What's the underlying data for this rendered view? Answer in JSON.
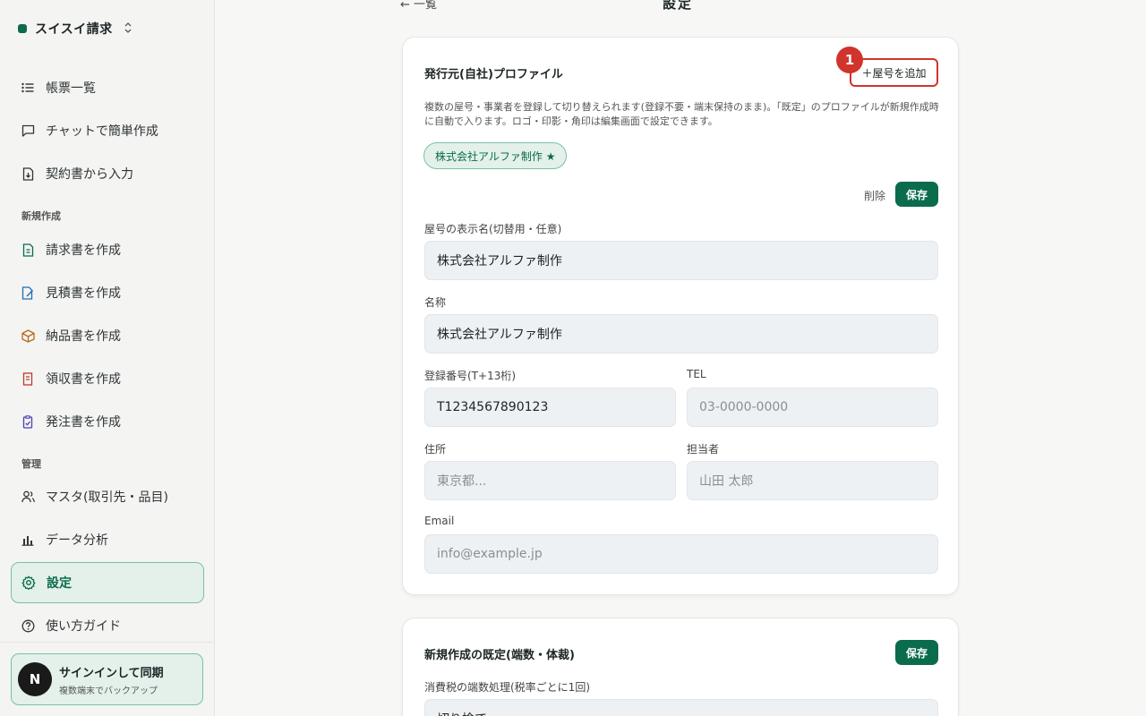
{
  "app": {
    "name": "スイスイ請求"
  },
  "sidebar": {
    "items": [
      {
        "label": "帳票一覧",
        "icon": "list-icon"
      },
      {
        "label": "チャットで簡単作成",
        "icon": "chat-icon"
      },
      {
        "label": "契約書から入力",
        "icon": "document-import-icon"
      },
      {
        "label": "請求書を作成",
        "icon": "invoice-icon"
      },
      {
        "label": "見積書を作成",
        "icon": "estimate-icon"
      },
      {
        "label": "納品書を作成",
        "icon": "box-icon"
      },
      {
        "label": "領収書を作成",
        "icon": "receipt-icon"
      },
      {
        "label": "発注書を作成",
        "icon": "order-icon"
      },
      {
        "label": "マスタ(取引先・品目)",
        "icon": "users-icon"
      },
      {
        "label": "データ分析",
        "icon": "bar-chart-icon"
      },
      {
        "label": "設定",
        "icon": "gear-icon"
      },
      {
        "label": "使い方ガイド",
        "icon": "help-icon"
      }
    ],
    "sections": {
      "create": "新規作成",
      "manage": "管理"
    },
    "signin": {
      "avatar": "N",
      "title": "サインインして同期",
      "subtitle": "複数端末でバックアップ"
    }
  },
  "header": {
    "back": "← 一覧",
    "title": "設定"
  },
  "profile_card": {
    "title": "発行元(自社)プロファイル",
    "add_button": "＋屋号を追加",
    "annotation": "1",
    "description": "複数の屋号・事業者を登録して切り替えられます(登録不要・端末保持のまま)。「既定」のプロファイルが新規作成時に自動で入ります。ロゴ・印影・角印は編集画面で設定できます。",
    "chip": "株式会社アルファ制作 ★",
    "delete": "削除",
    "save": "保存",
    "fields": {
      "display_name": {
        "label": "屋号の表示名(切替用・任意)",
        "value": "株式会社アルファ制作"
      },
      "name": {
        "label": "名称",
        "value": "株式会社アルファ制作"
      },
      "reg_no": {
        "label": "登録番号(T+13桁)",
        "value": "T1234567890123"
      },
      "tel": {
        "label": "TEL",
        "placeholder": "03-0000-0000"
      },
      "address": {
        "label": "住所",
        "placeholder": "東京都..."
      },
      "person": {
        "label": "担当者",
        "placeholder": "山田 太郎"
      },
      "email": {
        "label": "Email",
        "placeholder": "info@example.jp"
      }
    }
  },
  "defaults_card": {
    "title": "新規作成の既定(端数・体裁)",
    "save": "保存",
    "tax_rounding": {
      "label": "消費税の端数処理(税率ごとに1回)",
      "value": "切り捨て"
    }
  }
}
